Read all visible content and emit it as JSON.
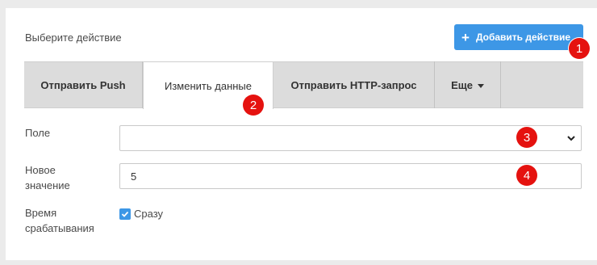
{
  "header": {
    "label": "Выберите действие",
    "add_button_label": "Добавить действие"
  },
  "tabs": [
    {
      "label": "Отправить Push"
    },
    {
      "label": "Изменить данные",
      "active": true
    },
    {
      "label": "Отправить HTTP-запрос"
    },
    {
      "label": "Еще"
    }
  ],
  "form": {
    "field_label": "Поле",
    "field_value": "",
    "new_value_label_line1": "Новое",
    "new_value_label_line2": "значение",
    "new_value": "5",
    "trigger_time_label_line1": "Время",
    "trigger_time_label_line2": "срабатывания",
    "immediately_label": "Сразу",
    "immediately_checked": true
  },
  "badges": [
    "1",
    "2",
    "3",
    "4"
  ],
  "colors": {
    "accent": "#3d97e6",
    "badge": "#e5120f"
  }
}
